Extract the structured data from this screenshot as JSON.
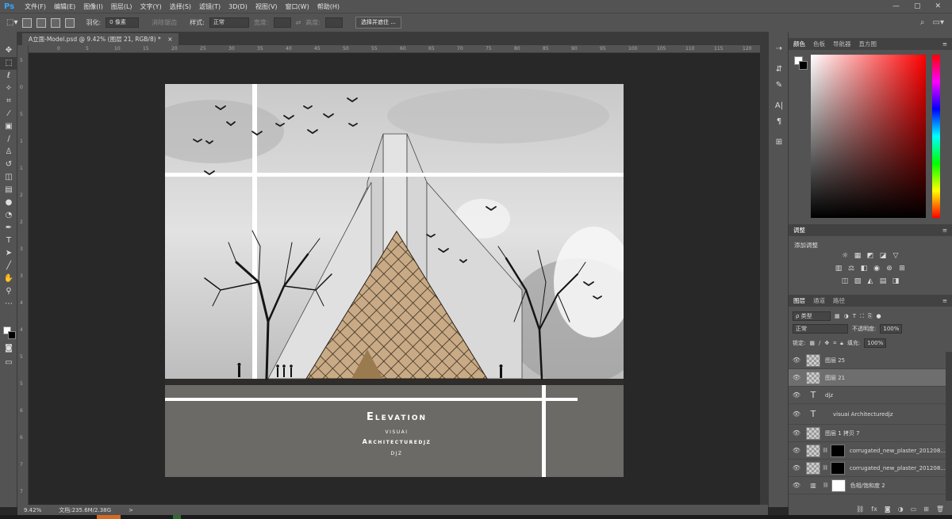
{
  "app": {
    "logo": "Ps",
    "window_controls": [
      "—",
      "▢",
      "✕"
    ]
  },
  "menu": [
    "文件(F)",
    "编辑(E)",
    "图像(I)",
    "图层(L)",
    "文字(Y)",
    "选择(S)",
    "滤镜(T)",
    "3D(D)",
    "视图(V)",
    "窗口(W)",
    "帮助(H)"
  ],
  "options": {
    "feather_label": "羽化:",
    "feather_value": "0 像素",
    "antialias_label": "消除锯齿",
    "style_label": "样式:",
    "style_value": "正常",
    "width_label": "宽度:",
    "height_label": "高度:",
    "select_mask_button": "选择并遮住 ..."
  },
  "document": {
    "tab_title": "A立面-Model.psd @ 9.42% (图层 21, RGB/8) *",
    "close": "×"
  },
  "rulers": {
    "top": [
      "0",
      "5",
      "10",
      "15",
      "20",
      "25",
      "30",
      "35",
      "40",
      "45",
      "50",
      "55",
      "60",
      "65",
      "70",
      "75",
      "80",
      "85",
      "90",
      "95",
      "100",
      "105",
      "110",
      "115",
      "120"
    ],
    "left": [
      "5",
      "0",
      "5",
      "1",
      "1",
      "2",
      "2",
      "3",
      "3",
      "4",
      "4",
      "5",
      "5",
      "6",
      "6",
      "7",
      "7"
    ]
  },
  "status": {
    "zoom": "9.42%",
    "doc_size": "文档:235.6M/2.38G",
    "arrow": ">"
  },
  "canvas": {
    "title": "Elevation",
    "line1": "visuai",
    "line2": "Architecturedjz",
    "line3": "djz"
  },
  "color_panel": {
    "tabs": [
      "颜色",
      "色板",
      "导航器",
      "直方图"
    ]
  },
  "adjust_panel": {
    "tab": "调整",
    "title": "添加调整"
  },
  "layers_panel": {
    "tabs": [
      "图层",
      "通道",
      "路径"
    ],
    "filter_kind": "ρ 类型",
    "blend_mode": "正常",
    "opacity_label": "不透明度:",
    "opacity_value": "100%",
    "lock_label": "锁定:",
    "fill_label": "填充:",
    "fill_value": "100%",
    "layers": [
      {
        "name": "图层 25",
        "kind": "pixel"
      },
      {
        "name": "图层 21",
        "kind": "pixel",
        "selected": true
      },
      {
        "name": "djz",
        "kind": "text"
      },
      {
        "name": "visuai Architecturedjz",
        "kind": "text"
      },
      {
        "name": "图层 1 拷贝 7",
        "kind": "pixel"
      },
      {
        "name": "corrugated_new_plaster_201208...",
        "kind": "masked"
      },
      {
        "name": "corrugated_new_plaster_201208...",
        "kind": "masked"
      },
      {
        "name": "色相/饱和度 2",
        "kind": "adjustment"
      }
    ]
  }
}
